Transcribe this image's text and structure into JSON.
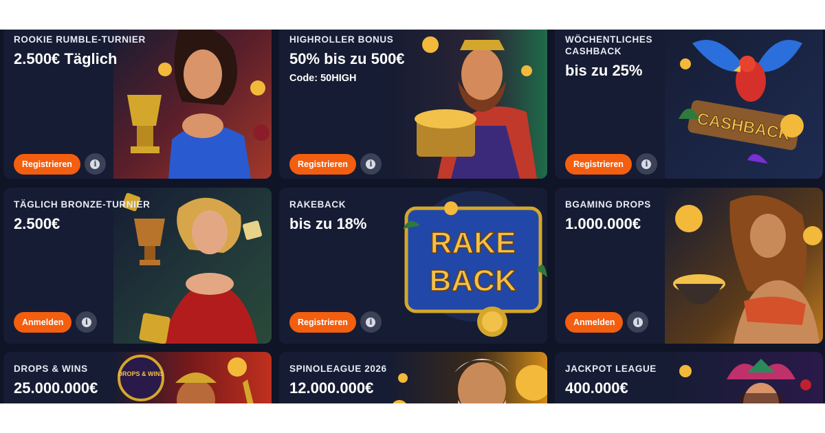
{
  "promotions": [
    {
      "label": "ROOKIE RUMBLE-TURNIER",
      "value": "2.500€ Täglich",
      "code": "",
      "button": "Registrieren",
      "art": "queen-with-trophy-illustration"
    },
    {
      "label": "HIGHROLLER BONUS",
      "value": "50% bis zu 500€",
      "code": "Code: 50HIGH",
      "button": "Registrieren",
      "art": "king-with-gold-chest-illustration"
    },
    {
      "label": "WÖCHENTLICHES CASHBACK",
      "value": "bis zu 25%",
      "code": "",
      "button": "Registrieren",
      "art": "parrot-cashback-sign-illustration",
      "art_text": "CASHBACK"
    },
    {
      "label": "TÄGLICH BRONZE-TURNIER",
      "value": "2.500€",
      "code": "",
      "button": "Anmelden",
      "art": "lady-with-bronze-trophy-illustration"
    },
    {
      "label": "RAKEBACK",
      "value": "bis zu 18%",
      "code": "",
      "button": "Registrieren",
      "art": "rakeback-sign-illustration",
      "art_text_1": "RAKE",
      "art_text_2": "BACK"
    },
    {
      "label": "BGAMING DROPS",
      "value": "1.000.000€",
      "code": "",
      "button": "Anmelden",
      "art": "woman-with-gold-pot-illustration"
    },
    {
      "label": "DROPS & WINS",
      "value": "25.000.000€",
      "code": "",
      "button": "",
      "art": "drops-wins-badge-illustration",
      "art_text": "DROPS & WINS"
    },
    {
      "label": "SPINOLEAGUE 2026",
      "value": "12.000.000€",
      "code": "",
      "button": "",
      "art": "bearded-god-illustration"
    },
    {
      "label": "JACKPOT LEAGUE",
      "value": "400.000€",
      "code": "",
      "button": "",
      "art": "jester-woman-illustration"
    }
  ],
  "info_icon": "info-icon",
  "colors": {
    "page_bg": "#0f1426",
    "card_bg": "#161c33",
    "button": "#f35e0f",
    "info_button": "#3b4157",
    "gold": "#f2b93b"
  }
}
